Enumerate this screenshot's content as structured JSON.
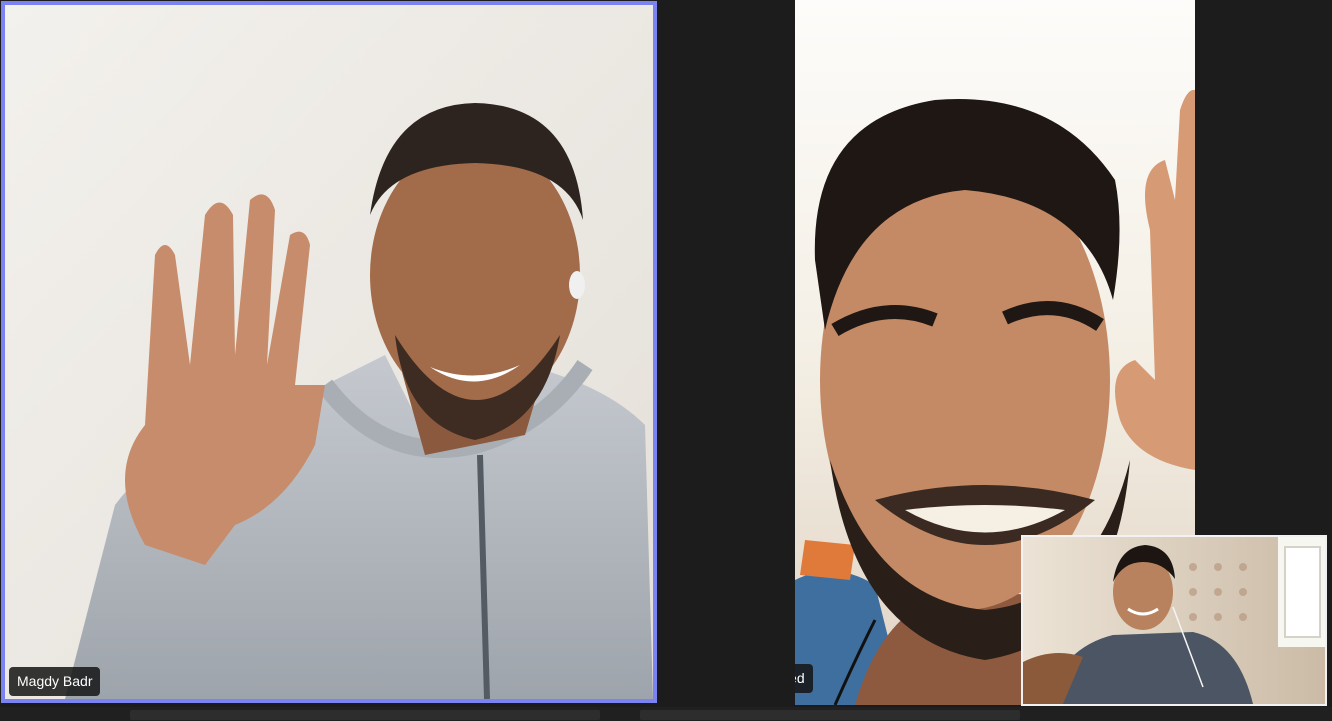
{
  "participants": [
    {
      "name": "Magdy Badr",
      "active_speaker": true
    },
    {
      "name": "Abdullah Mohamed",
      "active_speaker": false
    }
  ],
  "self_view": {
    "visible": true
  },
  "colors": {
    "active_speaker_border": "#7b83f2",
    "background": "#1c1c1c",
    "name_tag_bg": "#141414"
  }
}
